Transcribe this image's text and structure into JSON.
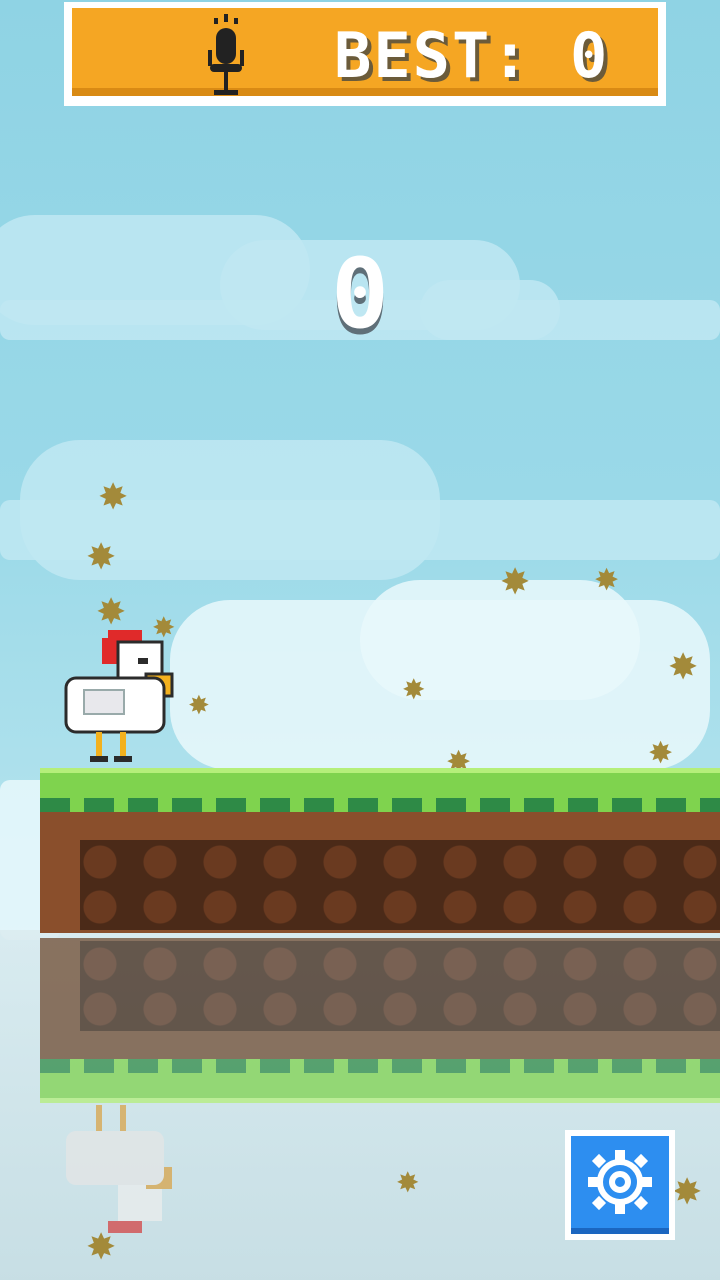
{
  "hud": {
    "best_label": "BEST: 0",
    "score": "0",
    "mic_icon": "microphone-icon",
    "settings_icon": "gear-icon"
  },
  "colors": {
    "hud_bar": "#f5a623",
    "settings_button": "#2d8ef0",
    "grass": "#7fd34e",
    "dirt": "#8a4f2c"
  }
}
